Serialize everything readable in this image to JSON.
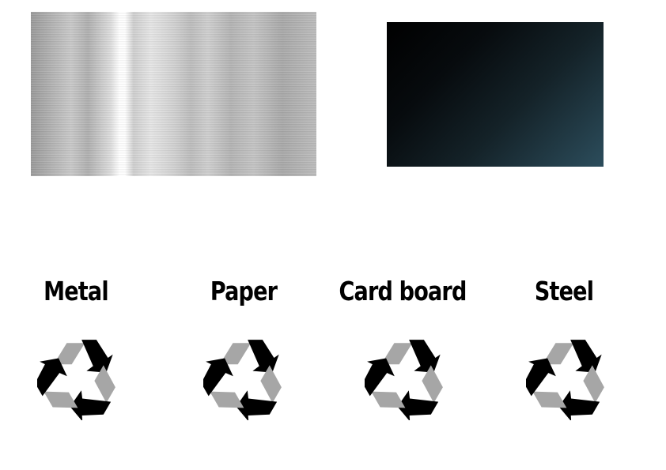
{
  "materials": [
    {
      "label": "Metal",
      "icon": "recycle-icon"
    },
    {
      "label": "Paper",
      "icon": "recycle-icon"
    },
    {
      "label": "Card board",
      "icon": "recycle-icon"
    },
    {
      "label": "Steel",
      "icon": "recycle-icon"
    }
  ],
  "colors": {
    "text": "#000000",
    "arrow_dark": "#000000",
    "arrow_light": "#a6a6a6",
    "metal_highlight": "#ffffff",
    "metal_base": "#b5b5b5",
    "dark_start": "#000000",
    "dark_end": "#2c4d5c"
  }
}
